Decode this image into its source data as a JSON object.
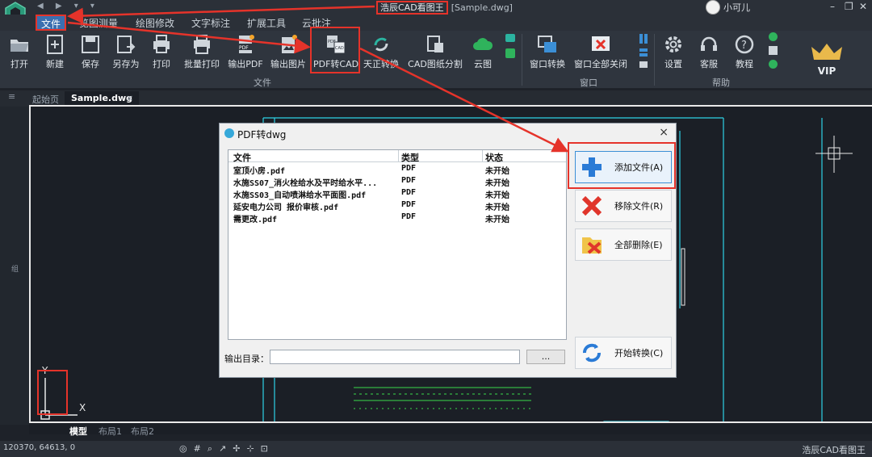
{
  "window": {
    "app_title": "浩辰CAD看图王",
    "file_title": "[Sample.dwg]",
    "user_name": "小可儿"
  },
  "menu": [
    "文件",
    "览图测量",
    "绘图修改",
    "文字标注",
    "扩展工具",
    "云批注"
  ],
  "ribbon": {
    "file_buttons": [
      {
        "label": "打开",
        "icon": "folder-open-icon"
      },
      {
        "label": "新建",
        "icon": "new-file-icon"
      },
      {
        "label": "保存",
        "icon": "save-icon"
      },
      {
        "label": "另存为",
        "icon": "save-as-icon"
      },
      {
        "label": "打印",
        "icon": "print-icon"
      },
      {
        "label": "批量打印",
        "icon": "batch-print-icon"
      },
      {
        "label": "输出PDF",
        "icon": "export-pdf-icon"
      },
      {
        "label": "输出图片",
        "icon": "export-image-icon"
      },
      {
        "label": "PDF转CAD",
        "icon": "pdf-to-cad-icon"
      },
      {
        "label": "天正转换",
        "icon": "tangent-convert-icon"
      },
      {
        "label": "CAD图纸分割",
        "icon": "split-drawing-icon"
      },
      {
        "label": "云图",
        "icon": "cloud-icon"
      }
    ],
    "window_buttons": [
      {
        "label": "窗口转换",
        "icon": "window-switch-icon"
      },
      {
        "label": "窗口全部关闭",
        "icon": "close-all-windows-icon"
      }
    ],
    "help_buttons": [
      {
        "label": "设置",
        "icon": "gear-icon"
      },
      {
        "label": "客服",
        "icon": "headset-icon"
      },
      {
        "label": "教程",
        "icon": "help-icon"
      }
    ],
    "group_labels": {
      "file": "文件",
      "window": "窗口",
      "help": "帮助"
    },
    "vip_label": "VIP"
  },
  "tabs": {
    "start": "起始页",
    "doc": "Sample.dwg",
    "close": "×"
  },
  "layouts": [
    "模型",
    "布局1",
    "布局2"
  ],
  "side_label": "组",
  "status": {
    "coords": "120370, 64613, 0",
    "brand": "浩辰CAD看图王"
  },
  "dialog": {
    "title": "PDF转dwg",
    "close": "×",
    "columns": [
      "文件",
      "类型",
      "状态"
    ],
    "rows": [
      {
        "file": "室顶小房.pdf",
        "type": "PDF",
        "status": "未开始"
      },
      {
        "file": "水施SS07_消火栓给水及平时给水平...",
        "type": "PDF",
        "status": "未开始"
      },
      {
        "file": "水施SS03_自动喷淋给水平面图.pdf",
        "type": "PDF",
        "status": "未开始"
      },
      {
        "file": "延安电力公司 报价审核.pdf",
        "type": "PDF",
        "status": "未开始"
      },
      {
        "file": "需更改.pdf",
        "type": "PDF",
        "status": "未开始"
      }
    ],
    "output_label": "输出目录：",
    "output_value": "",
    "browse": "...",
    "buttons": {
      "add": "添加文件(A)",
      "remove": "移除文件(R)",
      "delete_all": "全部删除(E)",
      "start": "开始转换(C)"
    }
  },
  "axis": {
    "y": "Y",
    "x": "X"
  },
  "colors": {
    "highlight": "#e5332a",
    "accent": "#3b6fb0",
    "dark_bg": "#1b1f26"
  }
}
